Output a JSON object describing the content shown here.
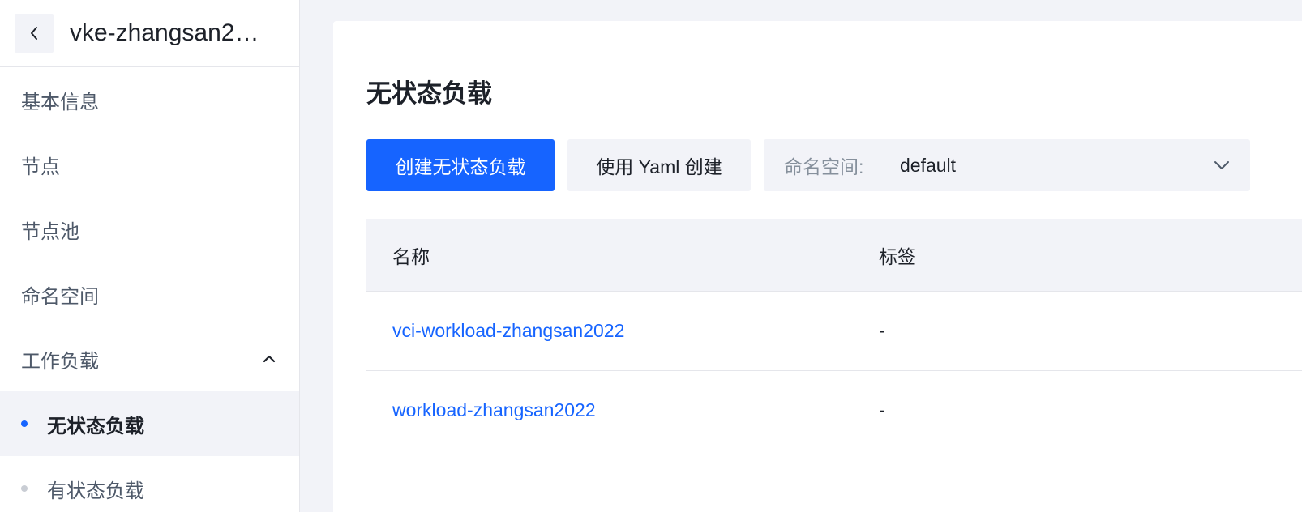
{
  "sidebar": {
    "cluster_name": "vke-zhangsan2…",
    "items": [
      {
        "label": "基本信息"
      },
      {
        "label": "节点"
      },
      {
        "label": "节点池"
      },
      {
        "label": "命名空间"
      },
      {
        "label": "工作负载"
      }
    ],
    "sub_items": [
      {
        "label": "无状态负载",
        "active": true
      },
      {
        "label": "有状态负载",
        "active": false
      }
    ]
  },
  "main": {
    "title": "无状态负载",
    "toolbar": {
      "create_label": "创建无状态负载",
      "yaml_label": "使用 Yaml 创建",
      "namespace_label": "命名空间:",
      "namespace_value": "default"
    },
    "table": {
      "columns": [
        "名称",
        "标签"
      ],
      "rows": [
        {
          "name": "vci-workload-zhangsan2022",
          "labels": "-"
        },
        {
          "name": "workload-zhangsan2022",
          "labels": "-"
        }
      ]
    }
  },
  "colors": {
    "primary": "#1664ff",
    "background": "#f2f3f8",
    "text": "#1d2129",
    "muted": "#4e5969"
  },
  "icons": [
    "chevron-left-icon",
    "chevron-up-icon",
    "chevron-down-icon",
    "dot-icon"
  ]
}
